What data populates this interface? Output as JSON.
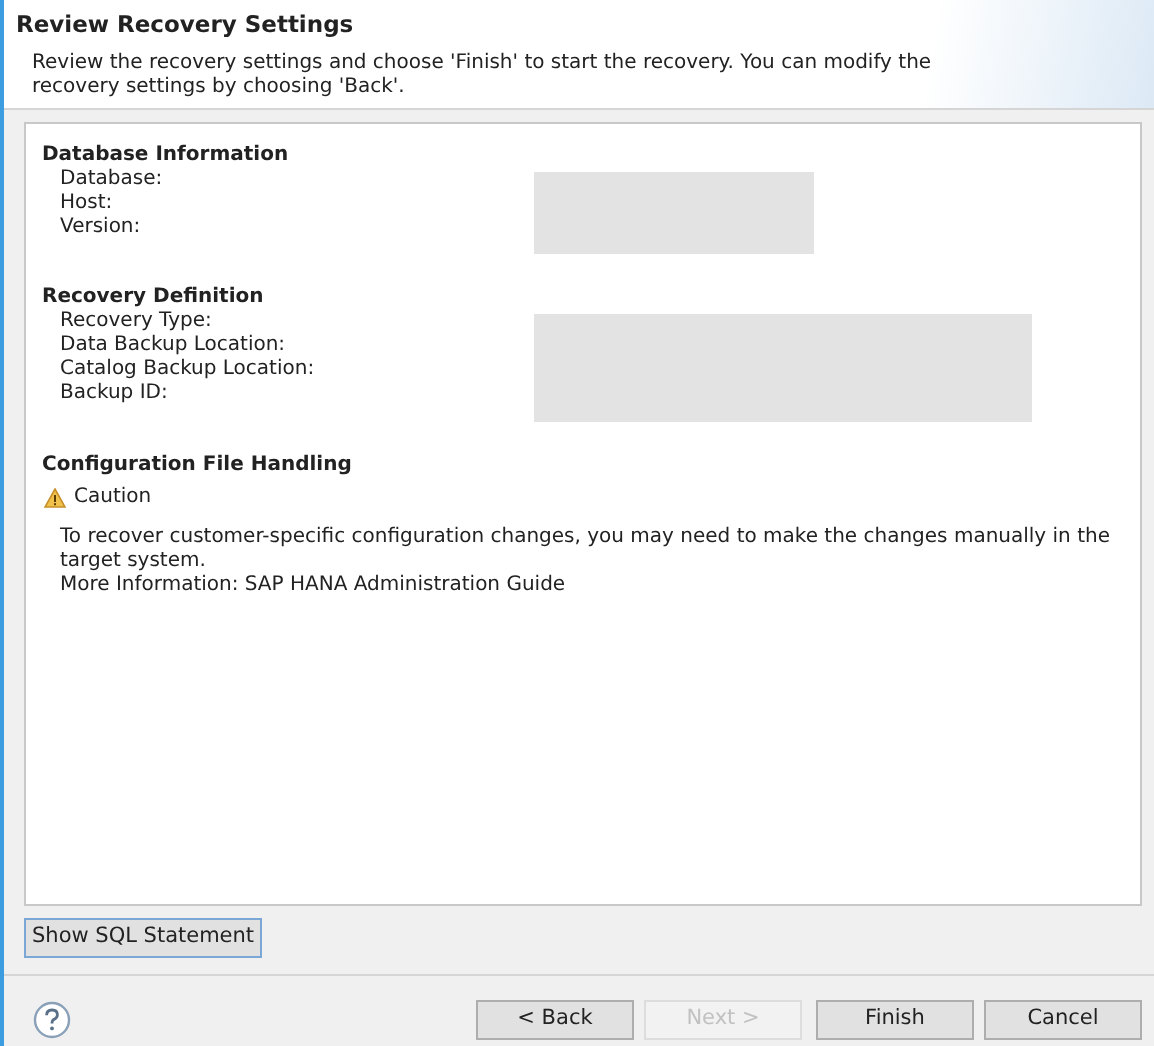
{
  "header": {
    "title": "Review Recovery Settings",
    "description": "Review the recovery settings and choose 'Finish' to start the recovery. You can modify the recovery settings by choosing 'Back'."
  },
  "sections": [
    {
      "kind": "fields",
      "heading": "Database Information",
      "labels": [
        "Database:",
        "Host:",
        "Version:"
      ],
      "values_redacted": true
    },
    {
      "kind": "fields",
      "heading": "Recovery Definition",
      "labels": [
        "Recovery Type:",
        "Data Backup Location:",
        "Catalog Backup Location:",
        "Backup ID:"
      ],
      "values_redacted": true
    },
    {
      "kind": "notice",
      "heading": "Configuration File Handling",
      "caution": "Caution",
      "lines": [
        "To recover customer-specific configuration changes, you may need to make the changes manually in the target system.",
        "More Information: SAP HANA Administration Guide"
      ]
    }
  ],
  "show_sql_button": "Show SQL Statement",
  "buttons": [
    {
      "label": "< Back",
      "disabled": false
    },
    {
      "label": "Next >",
      "disabled": true
    },
    {
      "label": "Finish",
      "disabled": false
    },
    {
      "label": "Cancel",
      "disabled": false
    }
  ]
}
